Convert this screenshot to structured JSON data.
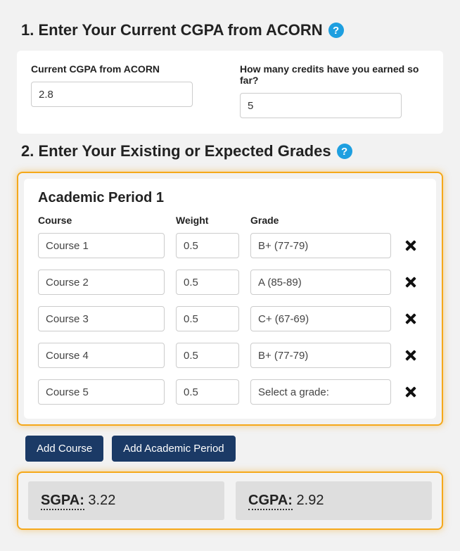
{
  "section1": {
    "title": "1. Enter Your Current CGPA from ACORN",
    "cgpa_label": "Current CGPA from ACORN",
    "cgpa_value": "2.8",
    "credits_label": "How many credits have you earned so far?",
    "credits_value": "5"
  },
  "section2": {
    "title": "2. Enter Your Existing or Expected Grades",
    "period_title": "Academic Period 1",
    "headers": {
      "course": "Course",
      "weight": "Weight",
      "grade": "Grade"
    },
    "rows": [
      {
        "course": "Course 1",
        "weight": "0.5",
        "grade": "B+ (77-79)"
      },
      {
        "course": "Course 2",
        "weight": "0.5",
        "grade": "A (85-89)"
      },
      {
        "course": "Course 3",
        "weight": "0.5",
        "grade": "C+ (67-69)"
      },
      {
        "course": "Course 4",
        "weight": "0.5",
        "grade": "B+ (77-79)"
      },
      {
        "course": "Course 5",
        "weight": "0.5",
        "grade": "Select a grade:"
      }
    ],
    "add_course_label": "Add Course",
    "add_period_label": "Add Academic Period"
  },
  "results": {
    "sgpa_label": "SGPA:",
    "sgpa_value": "3.22",
    "cgpa_label": "CGPA:",
    "cgpa_value": "2.92"
  }
}
